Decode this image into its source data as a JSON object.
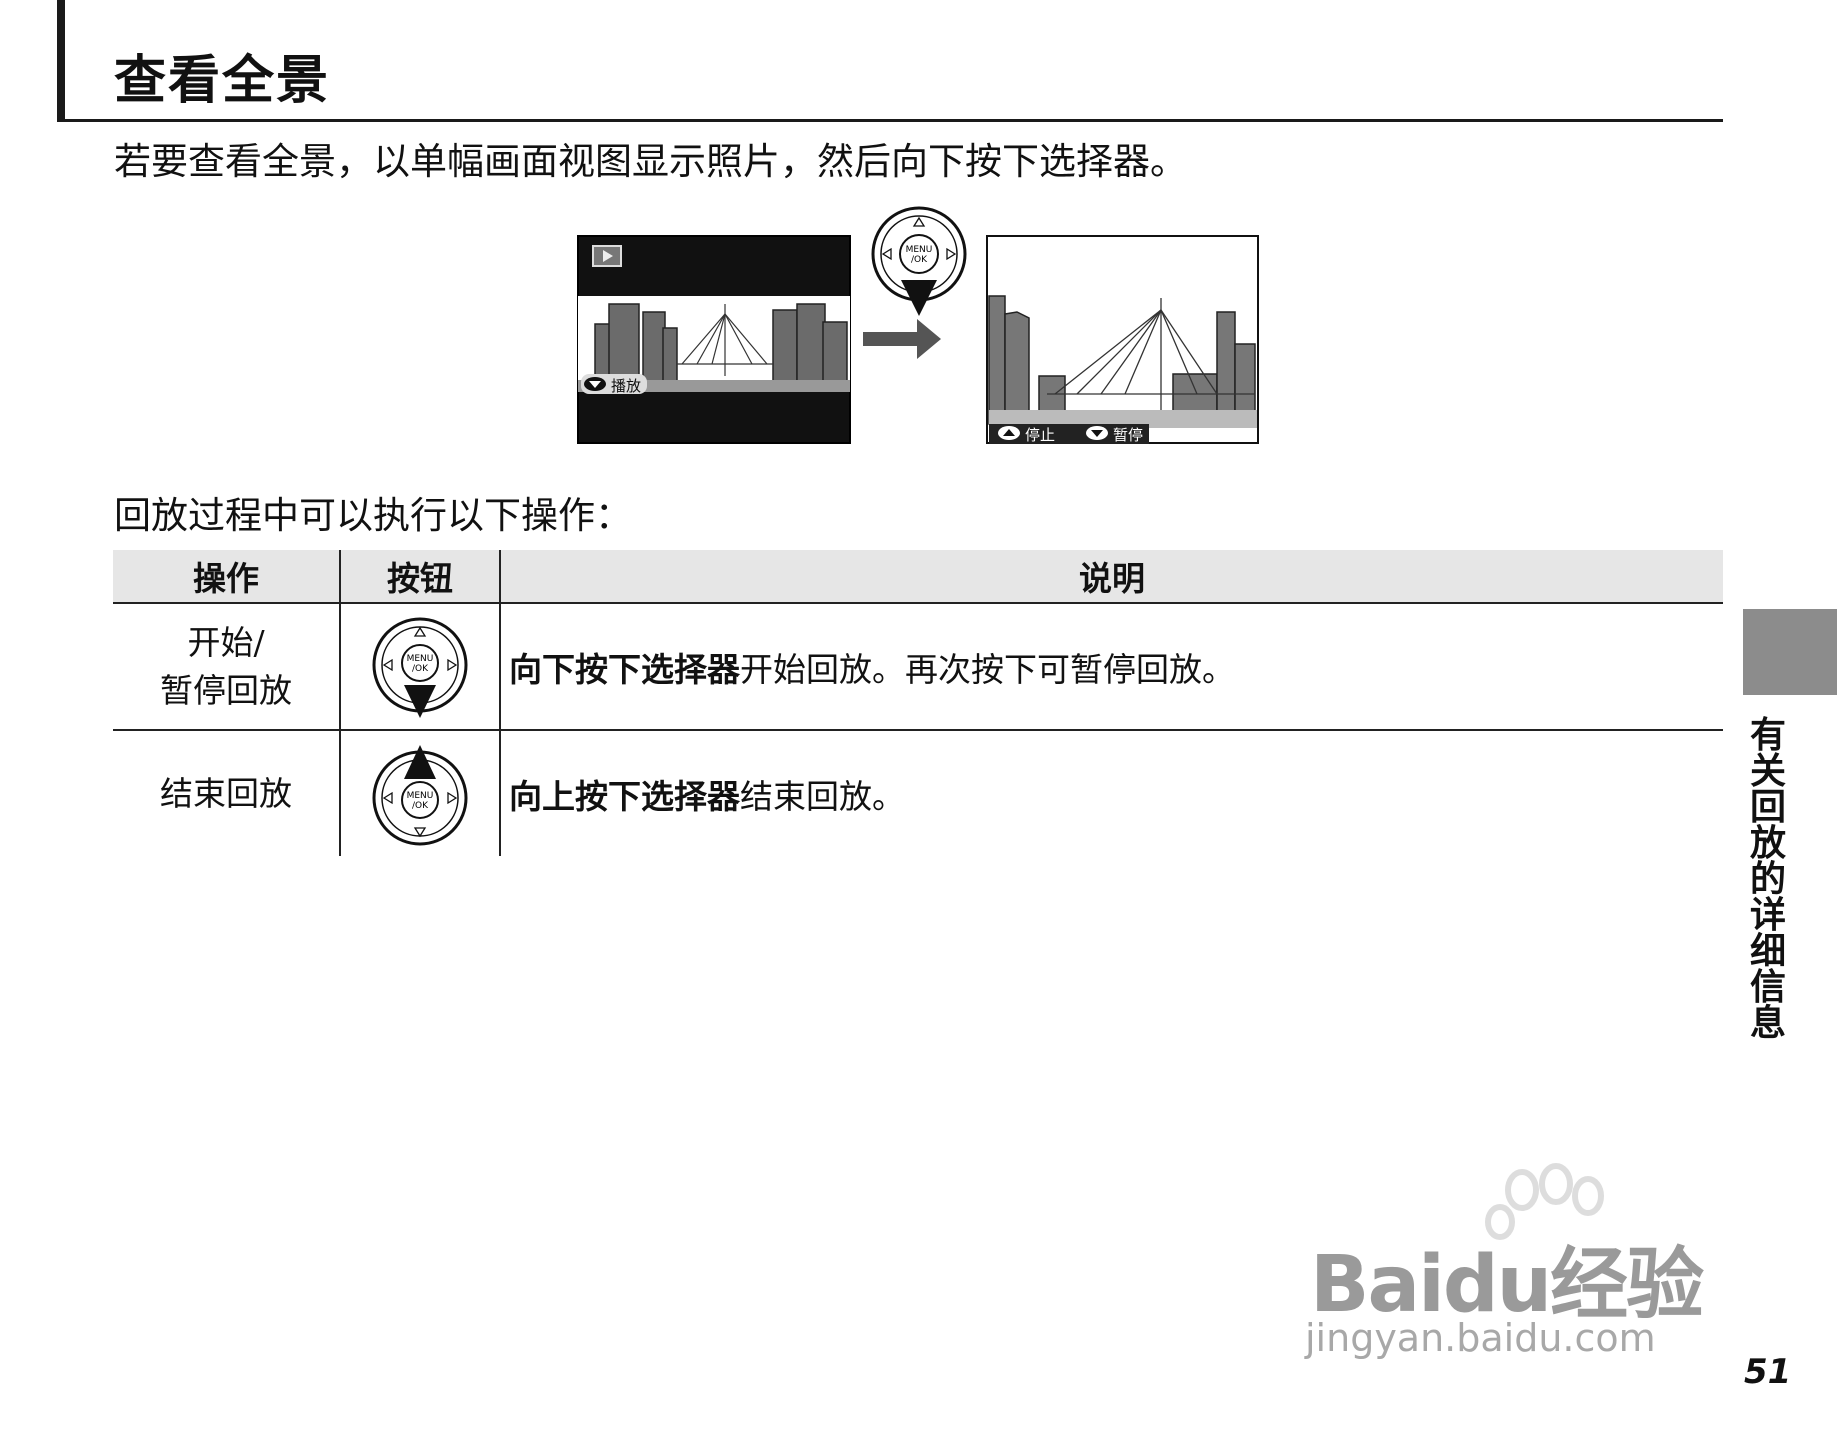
{
  "heading": {
    "title": "查看全景"
  },
  "intro": "若要查看全景，以单幅画面视图显示照片，然后向下按下选择器。",
  "illustration": {
    "screen_left": {
      "mode_icon": "playback-icon",
      "hint": "播放"
    },
    "selector_label": "MENU\n/OK",
    "selector_label_top": "MENU",
    "selector_label_bottom": "/OK",
    "screen_right": {
      "hint_stop": "停止",
      "hint_pause": "暂停"
    }
  },
  "lead": "回放过程中可以执行以下操作：",
  "table": {
    "headers": {
      "operation": "操作",
      "button": "按钮",
      "description": "说明"
    },
    "rows": [
      {
        "operation_line1": "开始/",
        "operation_line2": "暂停回放",
        "button_icon": "selector-down-icon",
        "desc_bold": "向下按下选择器",
        "desc_rest": "开始回放。再次按下可暂停回放。"
      },
      {
        "operation_line1": "结束回放",
        "button_icon": "selector-up-icon",
        "desc_bold": "向上按下选择器",
        "desc_rest": "结束回放。"
      }
    ]
  },
  "side_tab": {
    "label": "有关回放的详细信息"
  },
  "watermark": {
    "brand": "Baidu经验",
    "url": "jingyan.baidu.com"
  },
  "page_number": "51"
}
